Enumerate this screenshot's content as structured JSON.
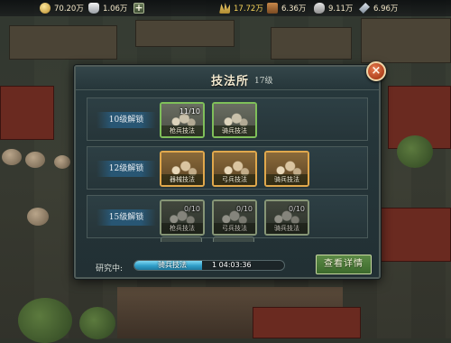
{
  "resources": {
    "coin": "70.20万",
    "ingot": "1.06万",
    "grain": "17.72万",
    "wood": "6.36万",
    "stone": "9.11万",
    "iron": "6.96万"
  },
  "panel": {
    "title": "技法所",
    "level": "17级",
    "close_symbol": "×"
  },
  "tiers": [
    {
      "unlock_label": "10级解锁",
      "skills": [
        {
          "count": "11/10",
          "name": "枪兵技法",
          "style": "green"
        },
        {
          "count": "",
          "name": "骑兵技法",
          "style": "green"
        }
      ]
    },
    {
      "unlock_label": "12级解锁",
      "skills": [
        {
          "count": "",
          "name": "器械技法",
          "style": "gold"
        },
        {
          "count": "",
          "name": "弓兵技法",
          "style": "gold"
        },
        {
          "count": "",
          "name": "骑兵技法",
          "style": "gold"
        }
      ]
    },
    {
      "unlock_label": "15级解锁",
      "skills": [
        {
          "count": "0/10",
          "name": "枪兵技法",
          "style": "locked"
        },
        {
          "count": "0/10",
          "name": "弓兵技法",
          "style": "locked"
        },
        {
          "count": "0/10",
          "name": "骑兵技法",
          "style": "locked"
        }
      ]
    }
  ],
  "research": {
    "label": "研究中:",
    "skill_name": "骑兵技法",
    "time_left": "1 04:03:36",
    "progress": 0.45
  },
  "detail_button": "查看详情"
}
